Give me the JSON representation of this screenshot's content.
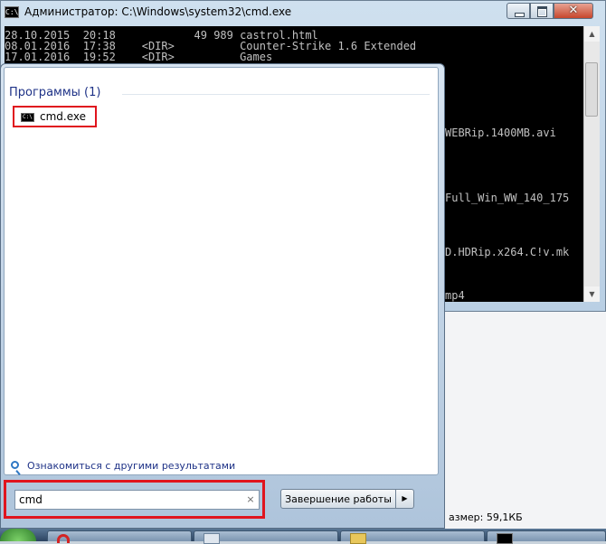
{
  "window": {
    "title": "Администратор: C:\\Windows\\system32\\cmd.exe",
    "icon": "cmd-icon",
    "icon_glyph": "C:\\",
    "buttons": {
      "minimize_icon": "minimize-icon",
      "maximize_icon": "maximize-icon",
      "close_icon": "close-icon",
      "close_glyph": "✕"
    }
  },
  "console": {
    "lines": [
      "28.10.2015  20:18            49 989 castrol.html",
      "08.01.2016  17:38    <DIR>          Counter-Strike 1.6 Extended",
      "17.01.2016  19:52    <DIR>          Games"
    ],
    "partial_lines": [
      "WEBRip.1400MB.avi",
      "Full_Win_WW_140_175",
      "D.HDRip.x264.C!v.mk",
      "mp4"
    ]
  },
  "start_menu": {
    "group_header": "Программы (1)",
    "results": [
      {
        "label": "cmd.exe",
        "icon": "cmd-icon",
        "icon_glyph": "C:\\"
      }
    ],
    "more_results": {
      "label": "Ознакомиться с другими результатами",
      "icon": "search-icon"
    },
    "search": {
      "value": "cmd",
      "clear_icon": "clear-icon",
      "clear_glyph": "×"
    },
    "shutdown": {
      "label": "Завершение работы",
      "arrow_icon": "arrow-right-icon",
      "arrow_glyph": "▶"
    }
  },
  "explorer": {
    "status_size": "азмер: 59,1КБ"
  },
  "taskbar": {
    "items": [
      {
        "icon": "opera-icon"
      },
      {
        "icon": "app-icon"
      },
      {
        "icon": "folder-icon"
      },
      {
        "icon": "cmd-icon"
      }
    ]
  },
  "colors": {
    "highlight": "#e0141e",
    "link": "#1e3287",
    "console_text": "#c0c0c0",
    "console_bg": "#000000"
  }
}
